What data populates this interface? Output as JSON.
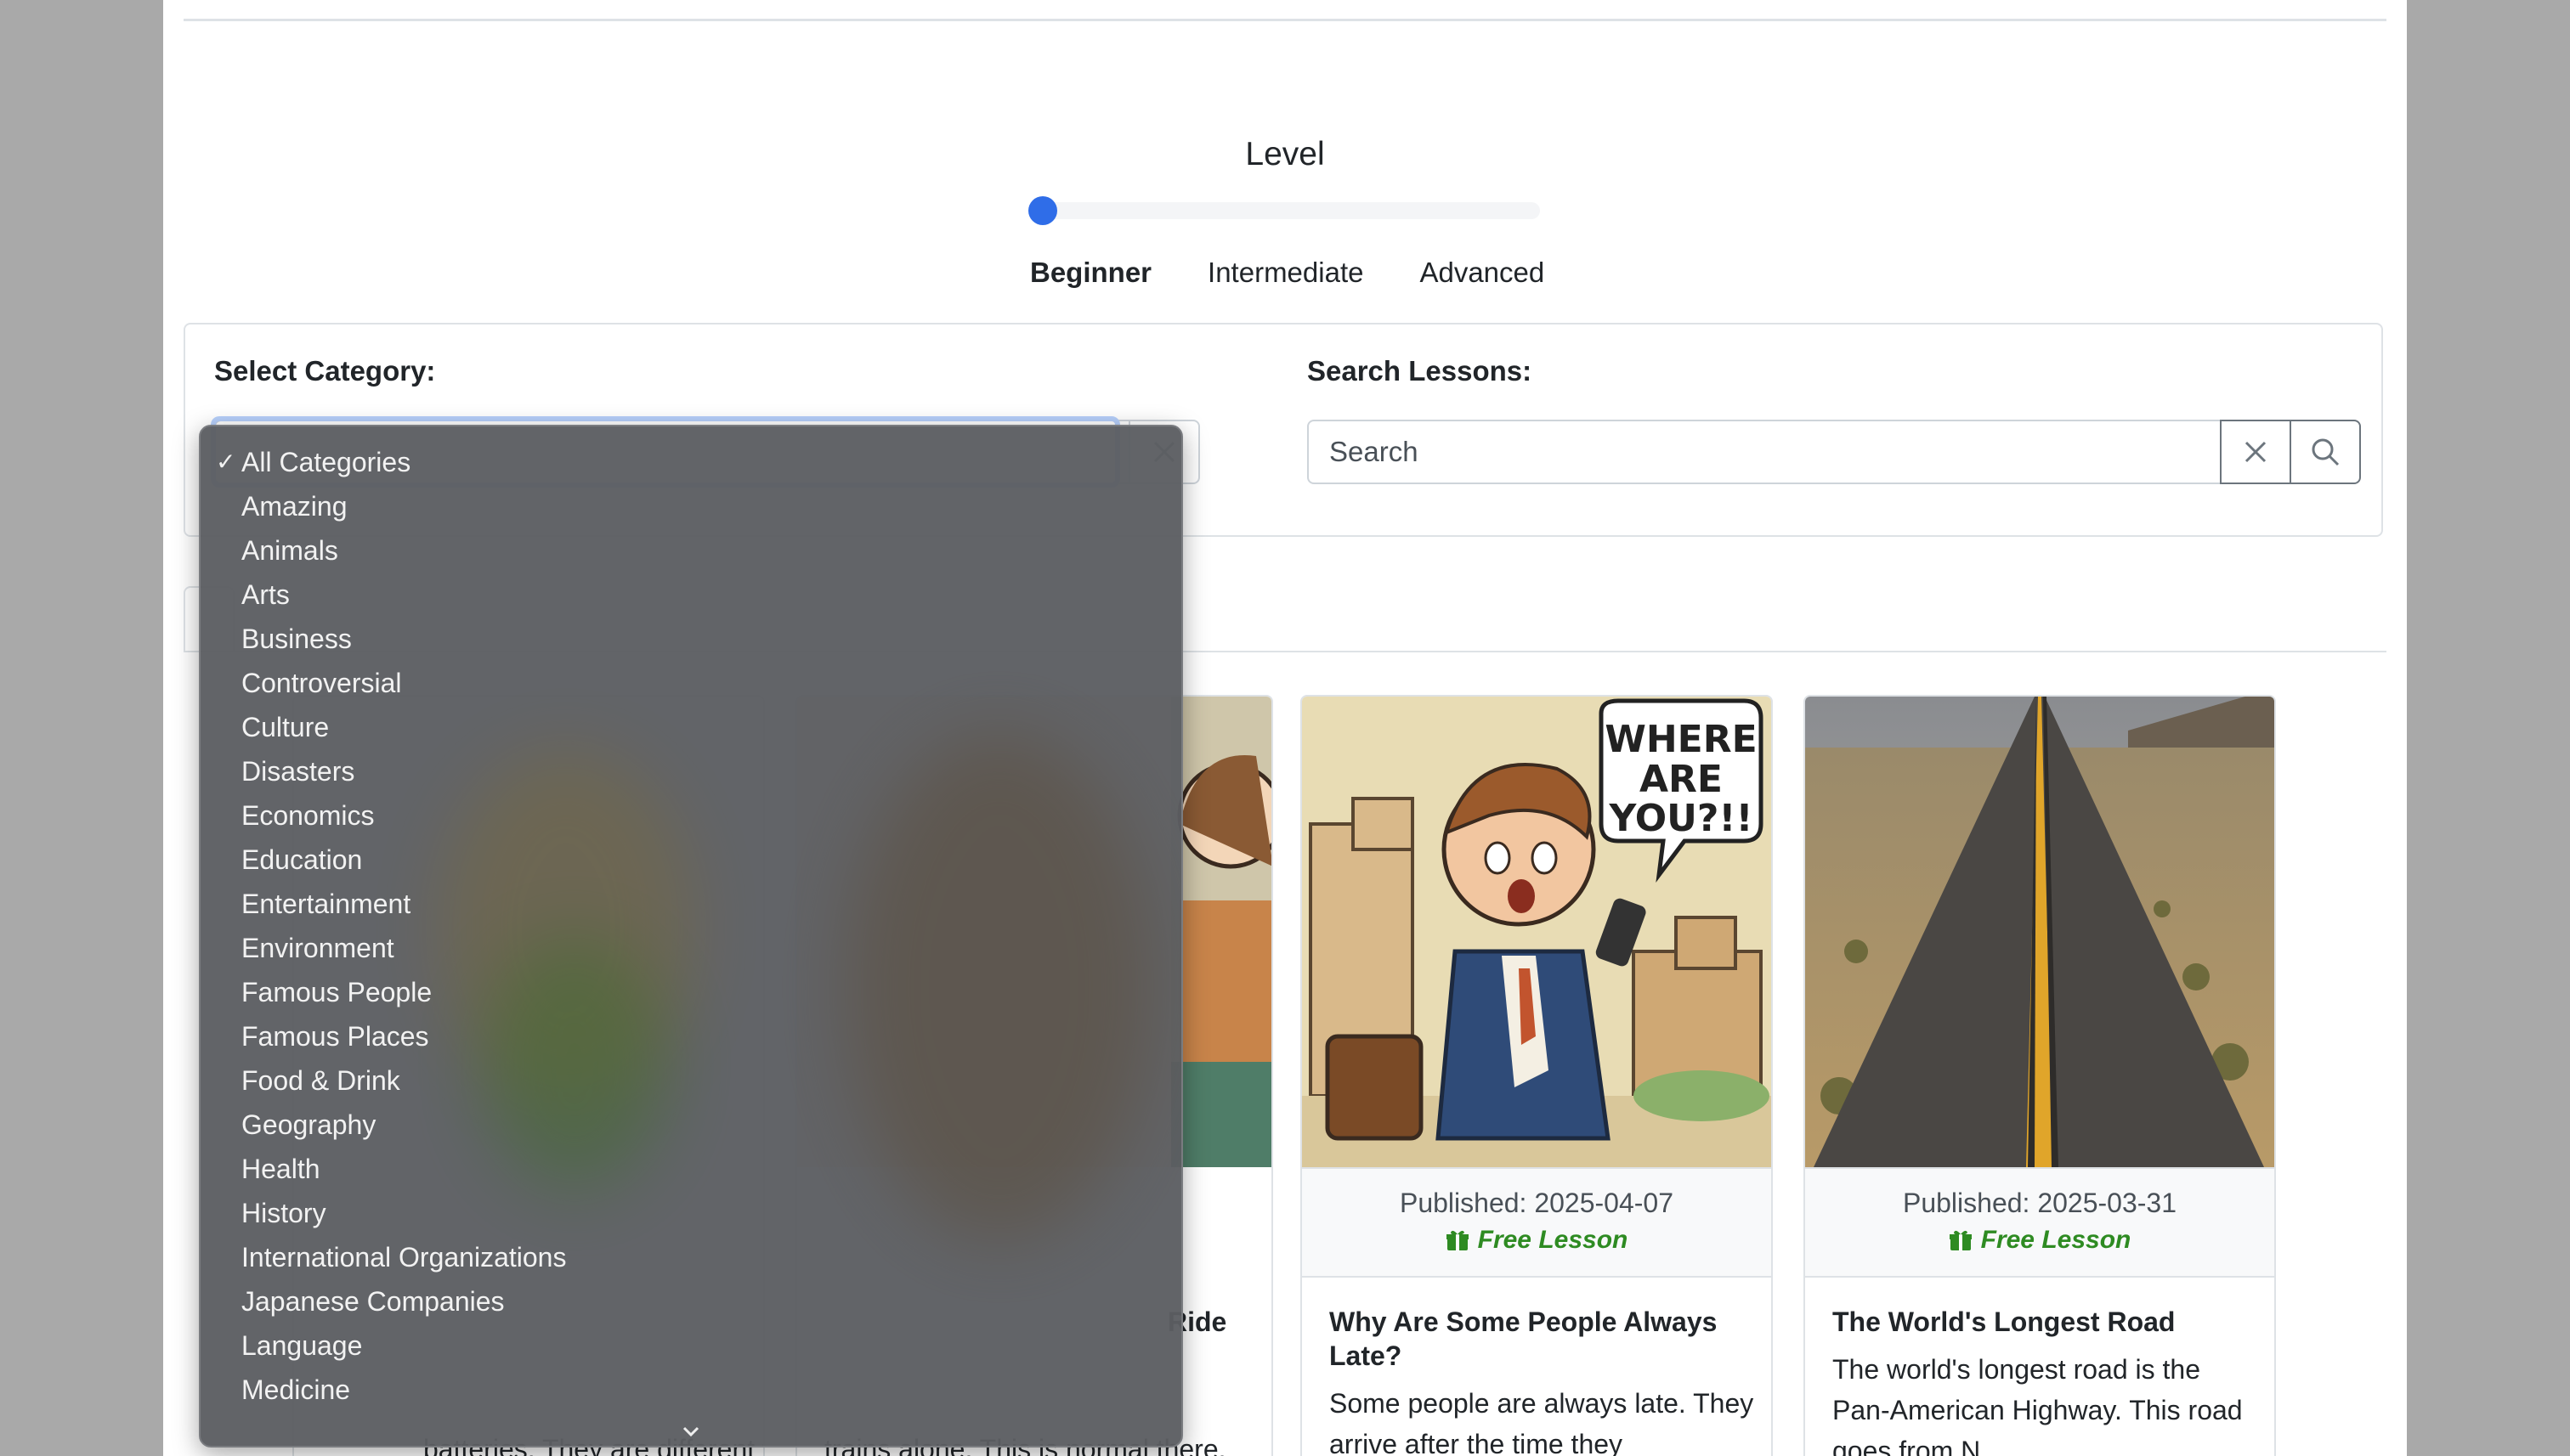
{
  "level": {
    "title": "Level",
    "value": 0,
    "options": [
      "Beginner",
      "Intermediate",
      "Advanced"
    ],
    "selected": "Beginner"
  },
  "filters": {
    "category_label": "Select Category:",
    "search_label": "Search Lessons:",
    "search_placeholder": "Search"
  },
  "dropdown": {
    "selected": "All Categories",
    "options": [
      "All Categories",
      "Amazing",
      "Animals",
      "Arts",
      "Business",
      "Controversial",
      "Culture",
      "Disasters",
      "Economics",
      "Education",
      "Entertainment",
      "Environment",
      "Famous People",
      "Famous Places",
      "Food & Drink",
      "Geography",
      "Health",
      "History",
      "International Organizations",
      "Japanese Companies",
      "Language",
      "Medicine"
    ]
  },
  "partial_cards": {
    "card1_text": "batteries. They are different from",
    "card2_title_tail": "Ride",
    "card2_text": "trains alone. This is normal there."
  },
  "cards": [
    {
      "image": "illustration-late-man-on-phone",
      "bubble": "WHERE ARE YOU?!!",
      "published": "Published: 2025-04-07",
      "free": "Free Lesson",
      "title": "Why Are Some People Always Late?",
      "text": "Some people are always late. They arrive after the time they"
    },
    {
      "image": "photo-long-desert-road",
      "published": "Published: 2025-03-31",
      "free": "Free Lesson",
      "title": "The World's Longest Road",
      "text": "The world's longest road is the Pan-American Highway. This road goes from N..."
    }
  ]
}
